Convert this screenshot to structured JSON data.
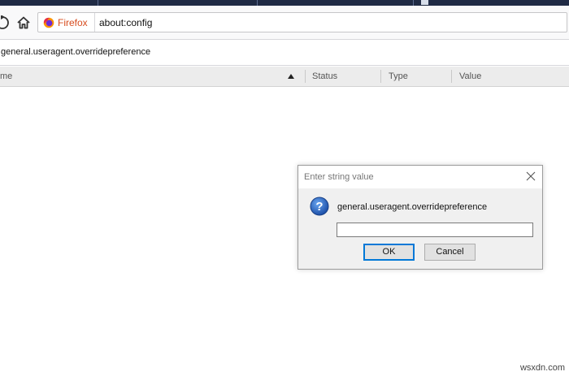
{
  "browser": {
    "identity_label": "Firefox",
    "url": "about:config",
    "brand_color": "#d74c1e"
  },
  "search": {
    "value": "general.useragent.overridepreference"
  },
  "columns": [
    "me",
    "Status",
    "Type",
    "Value"
  ],
  "dialog": {
    "title": "Enter string value",
    "message": "general.useragent.overridepreference",
    "input_value": "",
    "ok_label": "OK",
    "cancel_label": "Cancel",
    "icon": "question-icon"
  },
  "watermark": "wsxdn.com"
}
